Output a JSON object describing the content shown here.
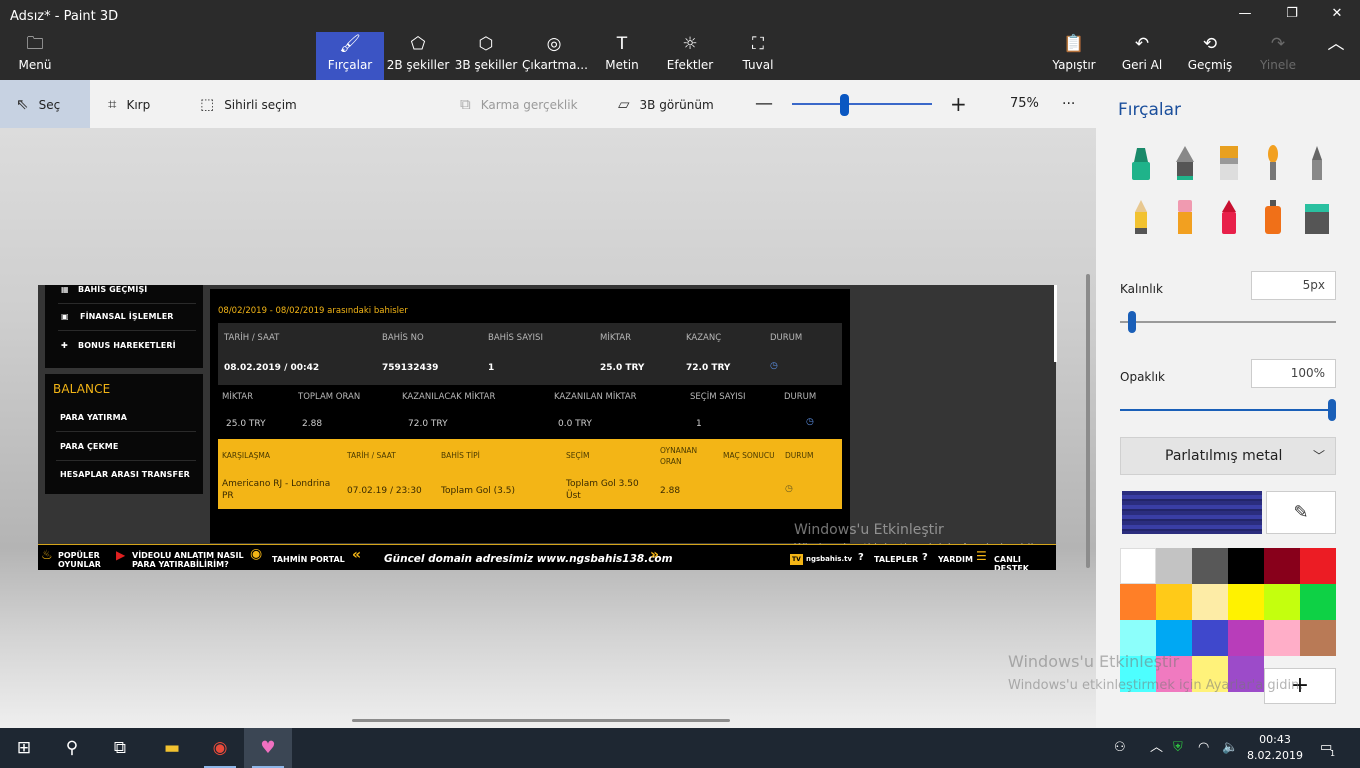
{
  "window": {
    "title": "Adsız* - Paint 3D",
    "minimize": "—",
    "maximize": "❐",
    "close": "✕"
  },
  "ribbon": {
    "menu": "Menü",
    "brushes": "Fırçalar",
    "shapes2d": "2B şekiller",
    "shapes3d": "3B şekiller",
    "stickers": "Çıkartma...",
    "text": "Metin",
    "effects": "Efektler",
    "canvas": "Tuval",
    "paste": "Yapıştır",
    "undo": "Geri Al",
    "history": "Geçmiş",
    "redo": "Yinele"
  },
  "toolbar": {
    "select": "Seç",
    "crop": "Kırp",
    "magic_select": "Sihirli seçim",
    "mixed_reality": "Karma gerçeklik",
    "view3d": "3B görünüm",
    "zoom_value": "75%",
    "zoom_fraction": 0.37,
    "more": "···"
  },
  "canvas": {
    "sidebar": {
      "history": "BAHİS GEÇMİŞİ",
      "finance": "FİNANSAL İŞLEMLER",
      "bonus": "BONUS HAREKETLERİ",
      "balance_title": "BALANCE",
      "deposit": "PARA YATIRMA",
      "withdraw": "PARA ÇEKME",
      "transfer": "HESAPLAR ARASI TRANSFER"
    },
    "date_range": "08/02/2019 - 08/02/2019 arasındaki bahisler",
    "table1": {
      "headers": [
        "TARİH / SAAT",
        "BAHİS NO",
        "BAHİS SAYISI",
        "MİKTAR",
        "KAZANÇ",
        "DURUM"
      ],
      "row": [
        "08.02.2019 / 00:42",
        "759132439",
        "1",
        "25.0 TRY",
        "72.0 TRY"
      ]
    },
    "table2": {
      "headers": [
        "MİKTAR",
        "TOPLAM ORAN",
        "KAZANILACAK MİKTAR",
        "KAZANILAN MİKTAR",
        "SEÇİM SAYISI",
        "DURUM"
      ],
      "row": [
        "25.0 TRY",
        "2.88",
        "72.0 TRY",
        "0.0 TRY",
        "1"
      ]
    },
    "table3": {
      "headers": [
        "KARŞILAŞMA",
        "TARİH / SAAT",
        "BAHİS TİPİ",
        "SEÇİM",
        "OYNANAN ORAN",
        "MAÇ SONUCU",
        "DURUM"
      ],
      "row": [
        "Americano RJ - Londrina PR",
        "07.02.19 / 23:30",
        "Toplam Gol (3.5)",
        "Toplam Gol 3.50 Üst",
        "2.88"
      ]
    },
    "bottom": {
      "popular": "POPÜLER OYUNLAR",
      "video": "VİDEOLU ANLATIM NASIL PARA YATIRABİLİRİM?",
      "tahmin": "TAHMİN PORTAL",
      "domain": "Güncel domain adresimiz www.ngsbahis138.com",
      "ngstv": "ngsbahis.tv",
      "requests": "TALEPLER",
      "help": "YARDIM",
      "support": "CANLI DESTEK"
    },
    "watermark_title": "Windows'u Etkinleştir",
    "watermark_sub": "Windows'u etkinleştirmek için Ayarlar'a gidin."
  },
  "panel": {
    "title": "Fırçalar",
    "thickness_label": "Kalınlık",
    "thickness_value": "5px",
    "opacity_label": "Opaklık",
    "opacity_value": "100%",
    "material": "Parlatılmış metal",
    "current_color": "#2b2d7e",
    "swatches": [
      "#ffffff",
      "#c3c3c3",
      "#585858",
      "#000000",
      "#88001b",
      "#ec1c24",
      "#ff7f27",
      "#ffca18",
      "#fdeca6",
      "#fff200",
      "#c4ff0e",
      "#0ed145",
      "#8cfffb",
      "#00a8f3",
      "#3f48cc",
      "#b83dba",
      "#ffaec8",
      "#b97a56",
      "#4dffff",
      "#f07ac0",
      "#fff27a",
      "#9c4bc9"
    ],
    "add": "+",
    "watermark_title": "Windows'u Etkinleştir",
    "watermark_sub": "Windows'u etkinleştirmek için Ayarlar'a gidin."
  },
  "taskbar": {
    "time": "00:43",
    "date": "8.02.2019",
    "notifications": "1"
  }
}
